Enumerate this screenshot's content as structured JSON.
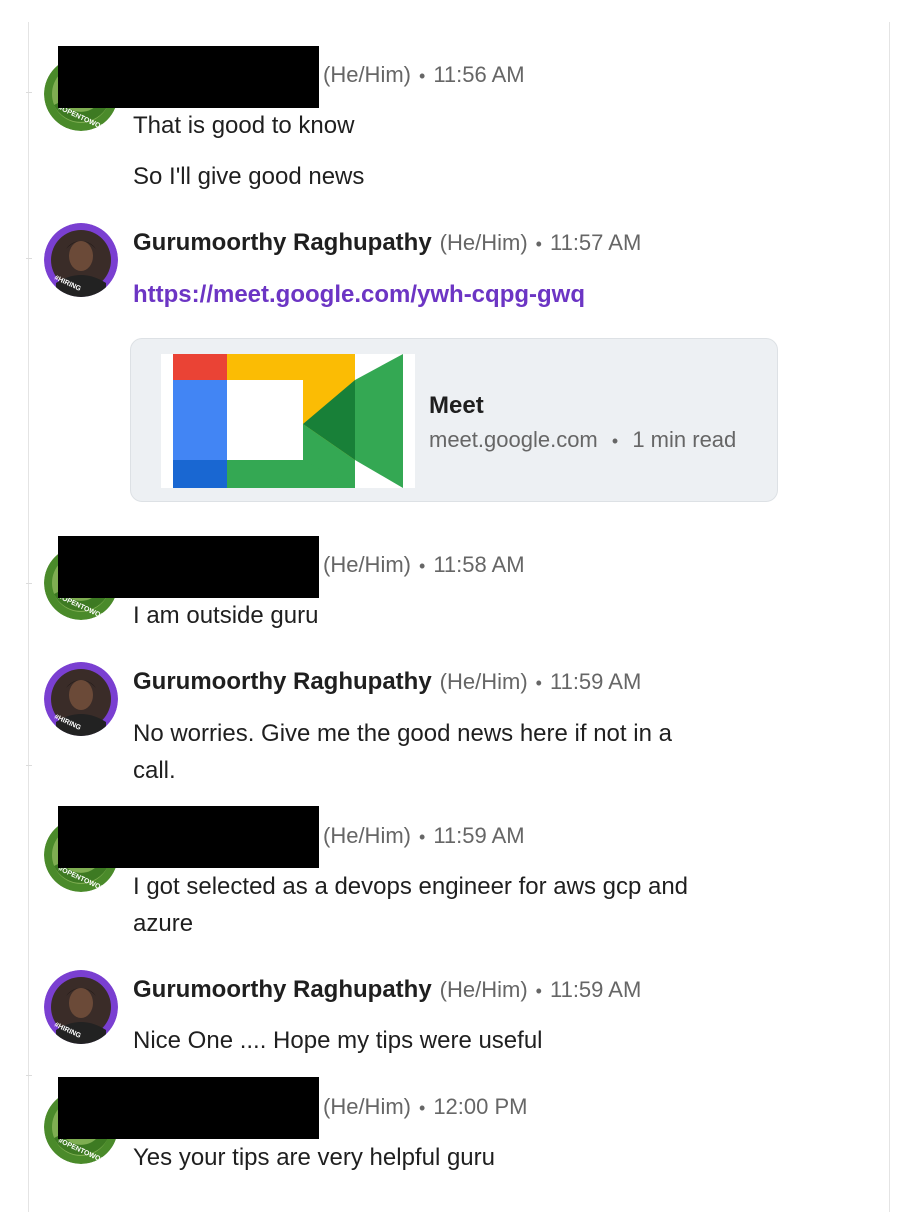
{
  "messages": [
    {
      "name": "",
      "pronoun": "(He/Him)",
      "time": "11:56 AM",
      "badge": "#OPENTOWORK",
      "lines": [
        "That is good to know",
        "So I'll give good news"
      ]
    },
    {
      "name": "Gurumoorthy Raghupathy",
      "pronoun": "(He/Him)",
      "time": "11:57 AM",
      "badge": "#HIRING",
      "link": "https://meet.google.com/ywh-cqpg-gwq"
    },
    {
      "name": "",
      "pronoun": "(He/Him)",
      "time": "11:58 AM",
      "badge": "#OPENTOWORK",
      "lines": [
        "I am outside guru"
      ]
    },
    {
      "name": "Gurumoorthy Raghupathy",
      "pronoun": "(He/Him)",
      "time": "11:59 AM",
      "badge": "#HIRING",
      "lines": [
        "No worries. Give me the good news here if not in a",
        "call."
      ]
    },
    {
      "name": "",
      "pronoun": "(He/Him)",
      "time": "11:59 AM",
      "badge": "#OPENTOWORK",
      "lines": [
        "I got selected as a devops engineer for aws gcp and",
        "azure"
      ]
    },
    {
      "name": "Gurumoorthy Raghupathy",
      "pronoun": "(He/Him)",
      "time": "11:59 AM",
      "badge": "#HIRING",
      "lines": [
        "Nice One .... Hope my tips were useful"
      ]
    },
    {
      "name": "",
      "pronoun": "(He/Him)",
      "time": "12:00 PM",
      "badge": "#OPENTOWORK",
      "lines": [
        "Yes your tips are very helpful guru"
      ]
    }
  ],
  "link_preview": {
    "title": "Meet",
    "domain": "meet.google.com",
    "read_time": "1 min read",
    "icon": "google-meet-logo"
  },
  "separator": "•",
  "colors": {
    "link": "#6c35c4",
    "hiring_ring": "#7a3fd1",
    "opentowork_ring": "#4a8a2a",
    "card_bg": "#edf0f3"
  }
}
